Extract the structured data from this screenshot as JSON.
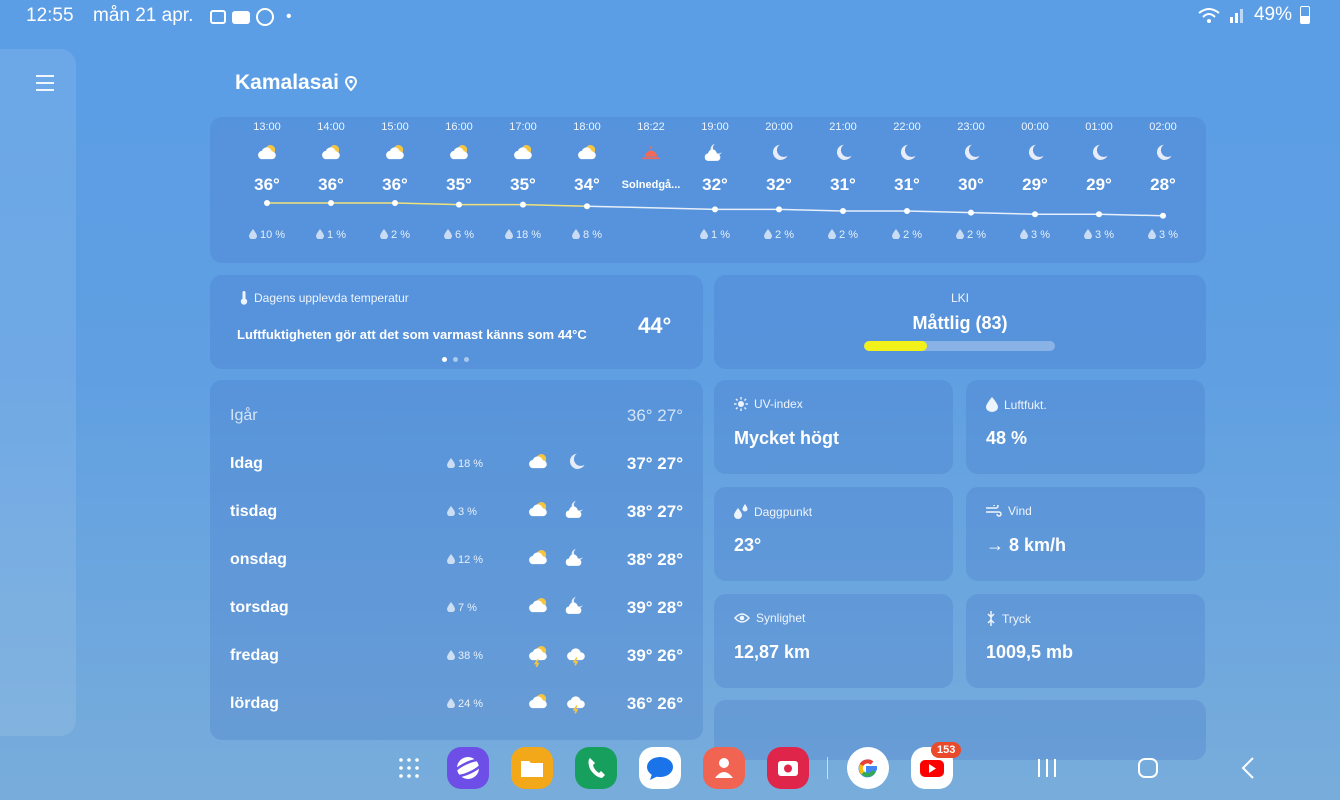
{
  "status": {
    "time": "12:55",
    "date": "mån 21 apr.",
    "dot": "•",
    "battery": "49%"
  },
  "location": {
    "name": "Kamalasai"
  },
  "hourly": [
    {
      "time": "13:00",
      "temp": "36°",
      "precip": "10 %",
      "icon": "partly-cloudy-day"
    },
    {
      "time": "14:00",
      "temp": "36°",
      "precip": "1 %",
      "icon": "partly-cloudy-day"
    },
    {
      "time": "15:00",
      "temp": "36°",
      "precip": "2 %",
      "icon": "partly-cloudy-day"
    },
    {
      "time": "16:00",
      "temp": "35°",
      "precip": "6 %",
      "icon": "partly-cloudy-day"
    },
    {
      "time": "17:00",
      "temp": "35°",
      "precip": "18 %",
      "icon": "partly-cloudy-day"
    },
    {
      "time": "18:00",
      "temp": "34°",
      "precip": "8 %",
      "icon": "partly-cloudy-day"
    },
    {
      "time": "18:22",
      "temp": "Solnedgå...",
      "precip": "",
      "icon": "sunset"
    },
    {
      "time": "19:00",
      "temp": "32°",
      "precip": "1 %",
      "icon": "partly-cloudy-night"
    },
    {
      "time": "20:00",
      "temp": "32°",
      "precip": "2 %",
      "icon": "moon"
    },
    {
      "time": "21:00",
      "temp": "31°",
      "precip": "2 %",
      "icon": "moon"
    },
    {
      "time": "22:00",
      "temp": "31°",
      "precip": "2 %",
      "icon": "moon"
    },
    {
      "time": "23:00",
      "temp": "30°",
      "precip": "2 %",
      "icon": "moon"
    },
    {
      "time": "00:00",
      "temp": "29°",
      "precip": "3 %",
      "icon": "moon"
    },
    {
      "time": "01:00",
      "temp": "29°",
      "precip": "3 %",
      "icon": "moon"
    },
    {
      "time": "02:00",
      "temp": "28°",
      "precip": "3 %",
      "icon": "moon"
    }
  ],
  "feels_like": {
    "label": "Dagens upplevda temperatur",
    "text": "Luftfuktigheten gör att det som varmast känns som 44°C",
    "value": "44°"
  },
  "aqi": {
    "label": "LKI",
    "value": "Måttlig (83)",
    "level": 0.33
  },
  "daily": [
    {
      "day": "Igår",
      "precip": "",
      "temps": "36° 27°",
      "icon_day": "",
      "icon_night": ""
    },
    {
      "day": "Idag",
      "precip": "18 %",
      "temps": "37° 27°",
      "icon_day": "partly-cloudy-day",
      "icon_night": "moon"
    },
    {
      "day": "tisdag",
      "precip": "3 %",
      "temps": "38° 27°",
      "icon_day": "partly-cloudy-day",
      "icon_night": "partly-cloudy-night"
    },
    {
      "day": "onsdag",
      "precip": "12 %",
      "temps": "38° 28°",
      "icon_day": "partly-cloudy-day",
      "icon_night": "partly-cloudy-night"
    },
    {
      "day": "torsdag",
      "precip": "7 %",
      "temps": "39° 28°",
      "icon_day": "partly-cloudy-day",
      "icon_night": "partly-cloudy-night"
    },
    {
      "day": "fredag",
      "precip": "38 %",
      "temps": "39° 26°",
      "icon_day": "thunder-rain",
      "icon_night": "thunder-cloud"
    },
    {
      "day": "lördag",
      "precip": "24 %",
      "temps": "36° 26°",
      "icon_day": "partly-cloudy-day",
      "icon_night": "thunder-cloud"
    }
  ],
  "tiles": {
    "uv": {
      "label": "UV-index",
      "value": "Mycket högt"
    },
    "humidity": {
      "label": "Luftfukt.",
      "value": "48 %"
    },
    "dew": {
      "label": "Daggpunkt",
      "value": "23°"
    },
    "wind": {
      "label": "Vind",
      "value": "→ 8 km/h"
    },
    "visibility": {
      "label": "Synlighet",
      "value": "12,87 km"
    },
    "pressure": {
      "label": "Tryck",
      "value": "1009,5 mb"
    }
  },
  "dock": {
    "youtube_badge": "153"
  },
  "colors": {
    "accent_yellow": "#f2f21a",
    "sun": "#f5c542",
    "badge": "#e84a2b"
  }
}
